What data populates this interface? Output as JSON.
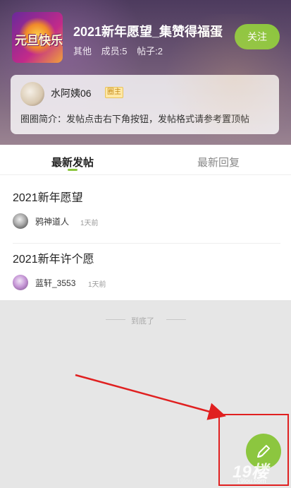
{
  "circle": {
    "logo_text": "元旦快乐",
    "title": "2021新年愿望_集赞得福蛋",
    "category": "其他",
    "members": "成员:5",
    "posts_count": "帖子:2",
    "follow_label": "关注",
    "owner_name": "水阿姨06",
    "owner_badge": "圈主",
    "intro": "圈圈简介：发帖点击右下角按钮，发帖格式请参考置顶帖"
  },
  "tabs": [
    {
      "label": "最新发帖",
      "active": true
    },
    {
      "label": "最新回复",
      "active": false
    }
  ],
  "posts": [
    {
      "title": "2021新年愿望",
      "author": "鸦神道人",
      "time": "1天前"
    },
    {
      "title": "2021新年许个愿",
      "author": "蓝轩_3553",
      "time": "1天前"
    }
  ],
  "end_text": "到底了",
  "fab_icon": "pencil-icon",
  "watermark": "19楼",
  "watermark_url": "19lou.com",
  "colors": {
    "accent": "#8cc63f",
    "annotation": "#e02020"
  }
}
